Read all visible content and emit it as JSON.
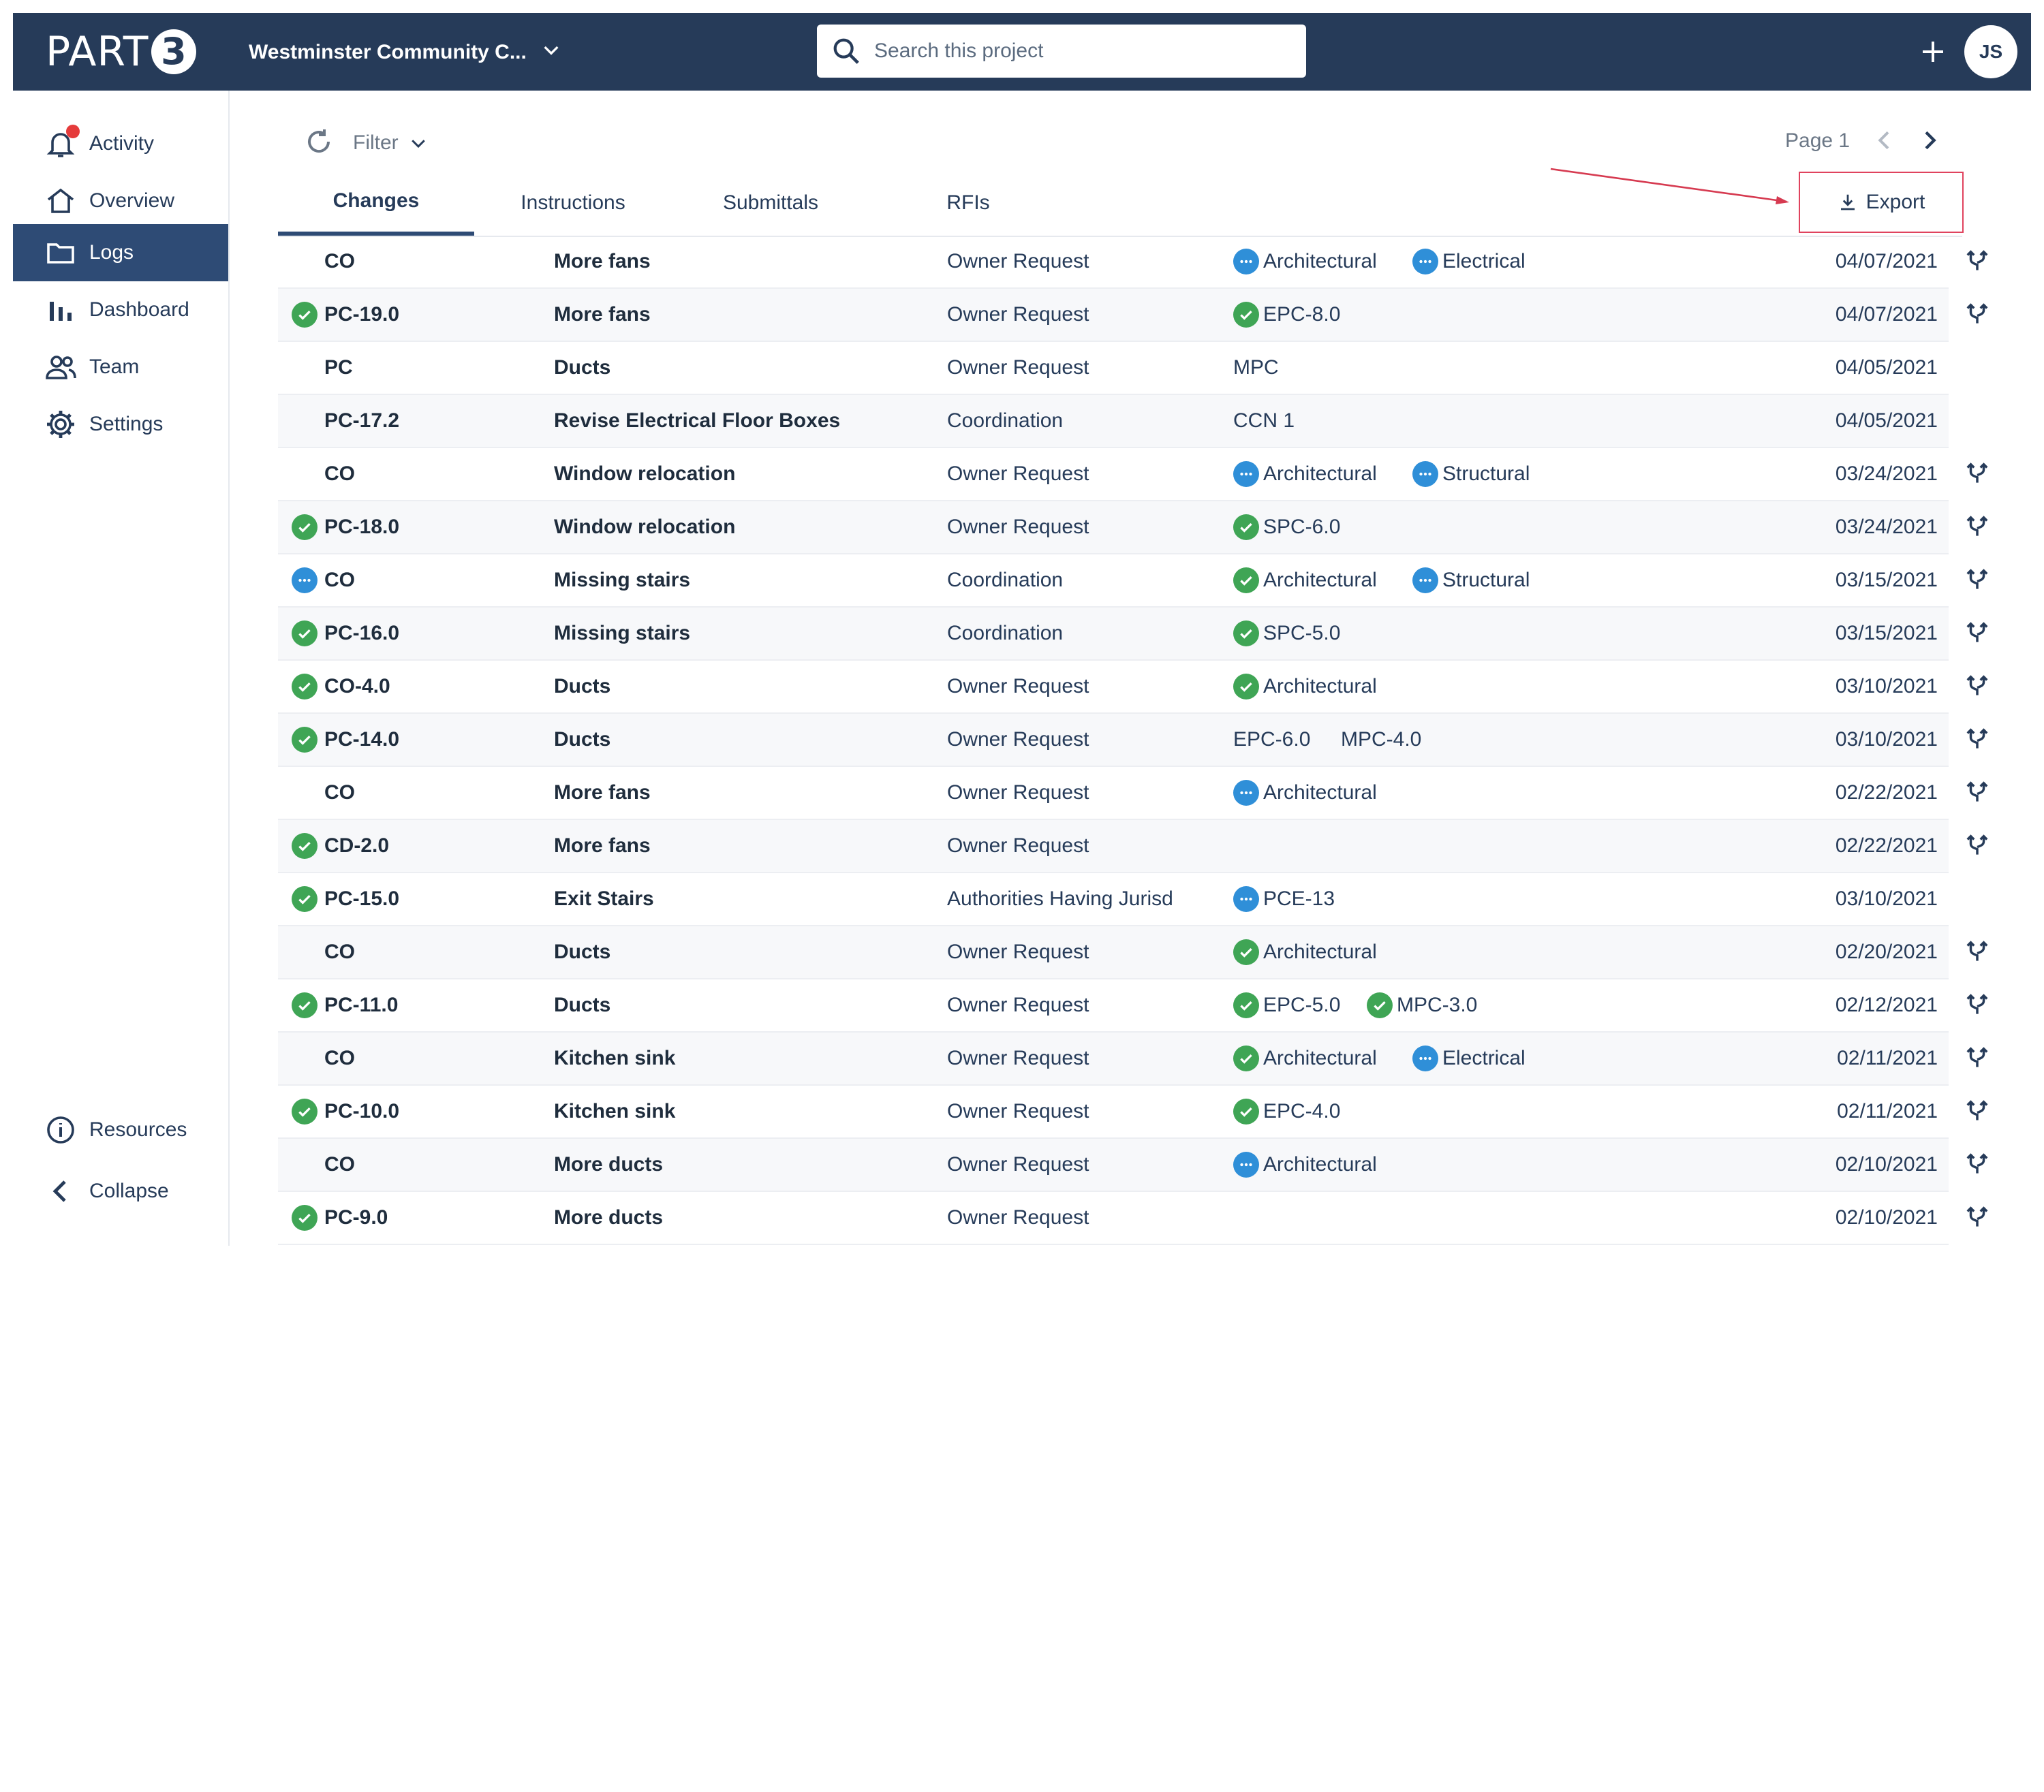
{
  "brand": {
    "logo_text": "PART",
    "logo_number": "3"
  },
  "header": {
    "project_name": "Westminster Community C...",
    "search_placeholder": "Search this project",
    "avatar_initials": "JS"
  },
  "sidebar": {
    "items": [
      {
        "label": "Activity",
        "icon": "bell-icon",
        "has_notification": true
      },
      {
        "label": "Overview",
        "icon": "home-icon"
      },
      {
        "label": "Logs",
        "icon": "folder-icon",
        "active": true
      },
      {
        "label": "Dashboard",
        "icon": "bar-chart-icon"
      },
      {
        "label": "Team",
        "icon": "team-icon"
      },
      {
        "label": "Settings",
        "icon": "gear-icon"
      }
    ],
    "bottom": [
      {
        "label": "Resources",
        "icon": "info-icon"
      },
      {
        "label": "Collapse",
        "icon": "chevron-left-icon"
      }
    ]
  },
  "toolbar": {
    "filter_label": "Filter",
    "page_label": "Page 1",
    "export_label": "Export"
  },
  "tabs": [
    "Changes",
    "Instructions",
    "Submittals",
    "RFIs"
  ],
  "colors": {
    "header_bg": "#263b59",
    "active_nav": "#2e4b75",
    "ok": "#3fa555",
    "pending": "#2f8fd8",
    "notification": "#e53b3b",
    "export_outline": "#e0435e"
  },
  "rows": [
    {
      "status": "",
      "code": "CO",
      "title": "More fans",
      "reason": "Owner Request",
      "tags": [
        {
          "status": "pending",
          "label": "Architectural"
        },
        {
          "status": "pending",
          "label": "Electrical"
        }
      ],
      "date": "04/07/2021",
      "branch": true
    },
    {
      "status": "ok",
      "code": "PC-19.0",
      "title": "More fans",
      "reason": "Owner Request",
      "tags": [
        {
          "status": "ok",
          "label": "EPC-8.0"
        }
      ],
      "date": "04/07/2021",
      "branch": true
    },
    {
      "status": "",
      "code": "PC",
      "title": "Ducts",
      "reason": "Owner Request",
      "tags": [
        {
          "status": "",
          "label": "MPC"
        }
      ],
      "date": "04/05/2021",
      "branch": false
    },
    {
      "status": "",
      "code": "PC-17.2",
      "title": "Revise Electrical Floor Boxes",
      "reason": "Coordination",
      "tags": [
        {
          "status": "",
          "label": "CCN 1"
        }
      ],
      "date": "04/05/2021",
      "branch": false
    },
    {
      "status": "",
      "code": "CO",
      "title": "Window relocation",
      "reason": "Owner Request",
      "tags": [
        {
          "status": "pending",
          "label": "Architectural"
        },
        {
          "status": "pending",
          "label": "Structural"
        }
      ],
      "date": "03/24/2021",
      "branch": true
    },
    {
      "status": "ok",
      "code": "PC-18.0",
      "title": "Window relocation",
      "reason": "Owner Request",
      "tags": [
        {
          "status": "ok",
          "label": "SPC-6.0"
        }
      ],
      "date": "03/24/2021",
      "branch": true
    },
    {
      "status": "pending",
      "code": "CO",
      "title": "Missing stairs",
      "reason": "Coordination",
      "tags": [
        {
          "status": "ok",
          "label": "Architectural"
        },
        {
          "status": "pending",
          "label": "Structural"
        }
      ],
      "date": "03/15/2021",
      "branch": true
    },
    {
      "status": "ok",
      "code": "PC-16.0",
      "title": "Missing stairs",
      "reason": "Coordination",
      "tags": [
        {
          "status": "ok",
          "label": "SPC-5.0"
        }
      ],
      "date": "03/15/2021",
      "branch": true
    },
    {
      "status": "ok",
      "code": "CO-4.0",
      "title": "Ducts",
      "reason": "Owner Request",
      "tags": [
        {
          "status": "ok",
          "label": "Architectural"
        }
      ],
      "date": "03/10/2021",
      "branch": true
    },
    {
      "status": "ok",
      "code": "PC-14.0",
      "title": "Ducts",
      "reason": "Owner Request",
      "tags": [
        {
          "status": "",
          "label": "EPC-6.0"
        },
        {
          "status": "",
          "label": "MPC-4.0"
        }
      ],
      "date": "03/10/2021",
      "branch": true
    },
    {
      "status": "",
      "code": "CO",
      "title": "More fans",
      "reason": "Owner Request",
      "tags": [
        {
          "status": "pending",
          "label": "Architectural"
        }
      ],
      "date": "02/22/2021",
      "branch": true
    },
    {
      "status": "ok",
      "code": "CD-2.0",
      "title": "More fans",
      "reason": "Owner Request",
      "tags": [],
      "date": "02/22/2021",
      "branch": true
    },
    {
      "status": "ok",
      "code": "PC-15.0",
      "title": "Exit Stairs",
      "reason": "Authorities Having Jurisd",
      "tags": [
        {
          "status": "pending",
          "label": "PCE-13"
        }
      ],
      "date": "03/10/2021",
      "branch": false
    },
    {
      "status": "",
      "code": "CO",
      "title": "Ducts",
      "reason": "Owner Request",
      "tags": [
        {
          "status": "ok",
          "label": "Architectural"
        }
      ],
      "date": "02/20/2021",
      "branch": true
    },
    {
      "status": "ok",
      "code": "PC-11.0",
      "title": "Ducts",
      "reason": "Owner Request",
      "tags": [
        {
          "status": "ok",
          "label": "EPC-5.0"
        },
        {
          "status": "ok",
          "label": "MPC-3.0"
        }
      ],
      "date": "02/12/2021",
      "branch": true
    },
    {
      "status": "",
      "code": "CO",
      "title": "Kitchen sink",
      "reason": "Owner Request",
      "tags": [
        {
          "status": "ok",
          "label": "Architectural"
        },
        {
          "status": "pending",
          "label": "Electrical"
        }
      ],
      "date": "02/11/2021",
      "branch": true
    },
    {
      "status": "ok",
      "code": "PC-10.0",
      "title": "Kitchen sink",
      "reason": "Owner Request",
      "tags": [
        {
          "status": "ok",
          "label": "EPC-4.0"
        }
      ],
      "date": "02/11/2021",
      "branch": true
    },
    {
      "status": "",
      "code": "CO",
      "title": "More ducts",
      "reason": "Owner Request",
      "tags": [
        {
          "status": "pending",
          "label": "Architectural"
        }
      ],
      "date": "02/10/2021",
      "branch": true
    },
    {
      "status": "ok",
      "code": "PC-9.0",
      "title": "More ducts",
      "reason": "Owner Request",
      "tags": [],
      "date": "02/10/2021",
      "branch": true
    }
  ]
}
